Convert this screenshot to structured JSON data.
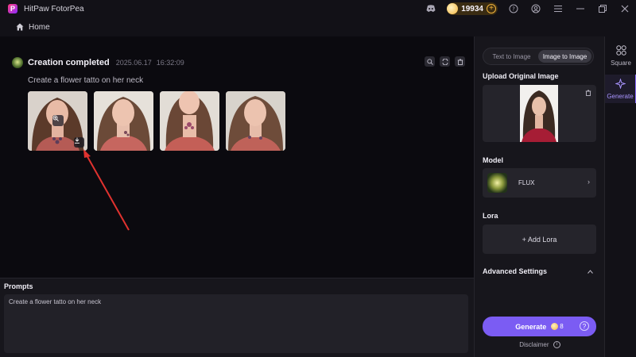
{
  "window": {
    "title": "HitPaw FotorPea",
    "coins": "19934"
  },
  "nav": {
    "home_label": "Home"
  },
  "creation": {
    "status": "Creation completed",
    "date": "2025.06.17",
    "time": "16:32:09",
    "prompt": "Create a flower tatto on her neck",
    "images": [
      {
        "name": "result-1"
      },
      {
        "name": "result-2"
      },
      {
        "name": "result-3"
      },
      {
        "name": "result-4"
      }
    ]
  },
  "prompts": {
    "title": "Prompts",
    "value": "Create a flower tatto on her neck"
  },
  "side": {
    "tabs": [
      {
        "label": "Text to Image",
        "active": false
      },
      {
        "label": "Image to Image",
        "active": true
      }
    ],
    "upload_title": "Upload Original Image",
    "model_title": "Model",
    "model_name": "FLUX",
    "lora_title": "Lora",
    "add_lora": "+ Add Lora",
    "advanced_title": "Advanced Settings",
    "generate_label": "Generate",
    "generate_cost": "8",
    "disclaimer": "Disclaimer"
  },
  "rail": {
    "items": [
      {
        "label": "Square",
        "icon": "grid-icon"
      },
      {
        "label": "Generate",
        "icon": "sparkle-icon",
        "active": true
      }
    ]
  },
  "colors": {
    "accent": "#7b5cf3",
    "annotation_arrow": "#e0322f",
    "coin": "#f2b33b"
  }
}
